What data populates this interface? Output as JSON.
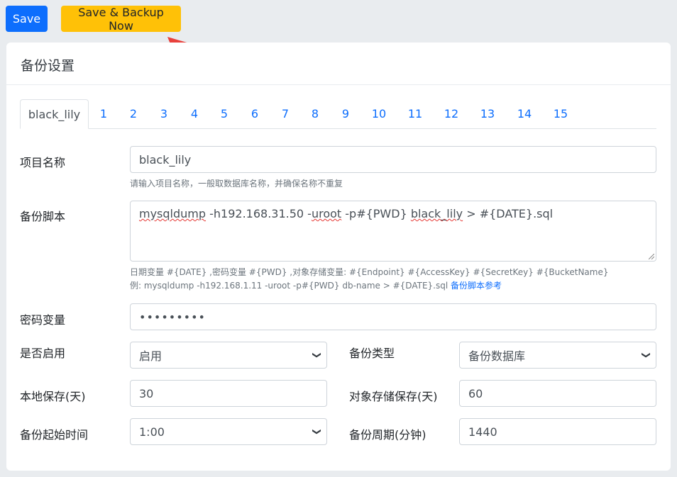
{
  "toolbar": {
    "save_label": "Save",
    "backup_label": "Save & Backup Now"
  },
  "card": {
    "title": "备份设置"
  },
  "tabs": [
    "black_lily",
    "1",
    "2",
    "3",
    "4",
    "5",
    "6",
    "7",
    "8",
    "9",
    "10",
    "11",
    "12",
    "13",
    "14",
    "15"
  ],
  "form": {
    "project_name": {
      "label": "项目名称",
      "value": "black_lily",
      "help": "请输入项目名称，一般取数据库名称，并确保名称不重复"
    },
    "script": {
      "label": "备份脚本",
      "segments": [
        "mysqldump",
        " -h192.168.31.50 -",
        "uroot",
        " -p#{PWD} ",
        "black_lily",
        " > #{DATE}.sql"
      ],
      "help_line1": "日期变量 #{DATE} ,密码变量 #{PWD} ,对象存储变量: #{Endpoint} #{AccessKey} #{SecretKey} #{BucketName}",
      "help_line2": "例: mysqldump -h192.168.1.11 -uroot -p#{PWD} db-name > #{DATE}.sql",
      "help_link": "备份脚本参考"
    },
    "password": {
      "label": "密码变量",
      "value": "•••••••••"
    },
    "enabled": {
      "label": "是否启用",
      "value": "启用"
    },
    "backup_type": {
      "label": "备份类型",
      "value": "备份数据库"
    },
    "local_keep": {
      "label": "本地保存(天)",
      "value": "30"
    },
    "object_keep": {
      "label": "对象存储保存(天)",
      "value": "60"
    },
    "start_time": {
      "label": "备份起始时间",
      "value": "1:00"
    },
    "period": {
      "label": "备份周期(分钟)",
      "value": "1440"
    }
  }
}
